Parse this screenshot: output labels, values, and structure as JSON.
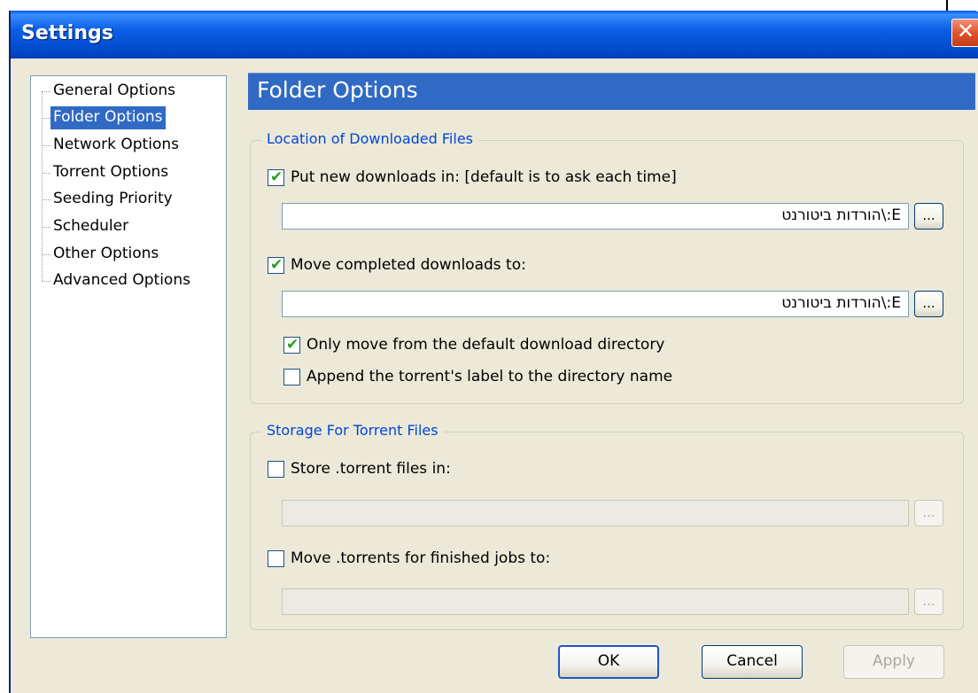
{
  "window": {
    "title": "Settings",
    "close_glyph": "✕"
  },
  "tree": {
    "items": [
      {
        "label": "General Options",
        "selected": false
      },
      {
        "label": "Folder Options",
        "selected": true
      },
      {
        "label": "Network Options",
        "selected": false
      },
      {
        "label": "Torrent Options",
        "selected": false
      },
      {
        "label": "Seeding Priority",
        "selected": false
      },
      {
        "label": "Scheduler",
        "selected": false
      },
      {
        "label": "Other Options",
        "selected": false
      },
      {
        "label": "Advanced Options",
        "selected": false
      }
    ]
  },
  "panel": {
    "title": "Folder Options"
  },
  "location_group": {
    "title": "Location of Downloaded Files",
    "put_new": {
      "label": "Put new downloads in: [default is to ask each time]",
      "checked": true
    },
    "put_new_path": "E:\\הורדות ביטורנט",
    "move_completed": {
      "label": "Move completed downloads to:",
      "checked": true
    },
    "move_completed_path": "E:\\הורדות ביטורנט",
    "only_move_default": {
      "label": "Only move from the default download directory",
      "checked": true
    },
    "append_label": {
      "label": "Append the torrent's label to the directory name",
      "checked": false
    },
    "browse_label": "..."
  },
  "storage_group": {
    "title": "Storage For Torrent Files",
    "store_torrent": {
      "label": "Store .torrent files in:",
      "checked": false
    },
    "store_torrent_path": "",
    "move_torrents": {
      "label": "Move .torrents for finished jobs to:",
      "checked": false
    },
    "move_torrents_path": "",
    "browse_label": "..."
  },
  "buttons": {
    "ok": "OK",
    "cancel": "Cancel",
    "apply": "Apply"
  },
  "check_glyph": "✔",
  "colors": {
    "selection": "#316ac5",
    "group_title": "#0046d5",
    "titlebar": "#0058ee",
    "dialog_bg": "#ece9d8"
  }
}
